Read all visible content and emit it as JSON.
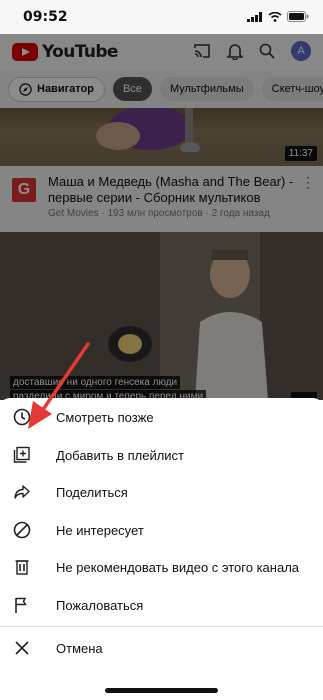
{
  "status_bar": {
    "time": "09:52"
  },
  "app": {
    "logo_text": "YouTube",
    "avatar_letter": "A"
  },
  "chips": [
    {
      "label": "Навигатор"
    },
    {
      "label": "Все"
    },
    {
      "label": "Мультфильмы"
    },
    {
      "label": "Скетч-шоу"
    }
  ],
  "video1": {
    "duration": "11:37"
  },
  "video2": {
    "channel_initial": "G",
    "title": "Маша и Медведь (Masha and The Bear) - первые серии - Сборник мультиков",
    "meta": "Get Movies · 193 млн просмотров · 2 года назад"
  },
  "video3": {
    "caption_line1": "доставшие ни одного генсека люди",
    "caption_line2": "разделили с миром и теперь перед ними"
  },
  "menu": {
    "items": [
      {
        "label": "Смотреть позже",
        "icon": "clock-icon"
      },
      {
        "label": "Добавить в плейлист",
        "icon": "playlist-add-icon"
      },
      {
        "label": "Поделиться",
        "icon": "share-icon"
      },
      {
        "label": "Не интересует",
        "icon": "block-icon"
      },
      {
        "label": "Не рекомендовать видео с этого канала",
        "icon": "trash-icon"
      },
      {
        "label": "Пожаловаться",
        "icon": "flag-icon"
      }
    ],
    "cancel_label": "Отмена",
    "cancel_icon": "close-icon"
  },
  "colors": {
    "brand": "#e10000",
    "annotation_arrow": "#e53935"
  }
}
